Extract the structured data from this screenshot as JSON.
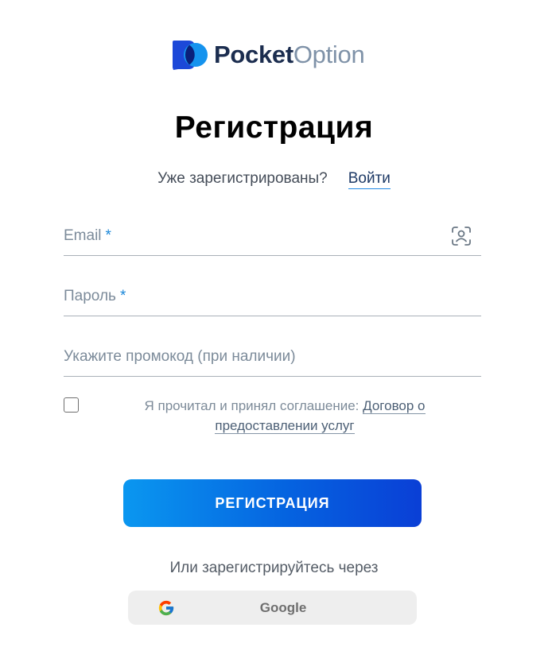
{
  "brand": {
    "name_part1": "Pocket",
    "name_part2": "Option",
    "colors": {
      "dark": "#1b2d4f",
      "muted": "#7f92a8",
      "primary_blue": "#0563e0",
      "accent_blue": "#1a87d9"
    },
    "icon": "pocket-option-logo-icon"
  },
  "page": {
    "title": "Регистрация"
  },
  "login": {
    "question": "Уже зарегистрированы?",
    "link_label": "Войти"
  },
  "form": {
    "email": {
      "label": "Email",
      "required_mark": "*",
      "value": "",
      "icon": "face-id-icon"
    },
    "password": {
      "label": "Пароль",
      "required_mark": "*",
      "value": ""
    },
    "promo": {
      "label": "Укажите промокод (при наличии)",
      "value": ""
    },
    "agreement": {
      "checked": false,
      "text": "Я прочитал и принял соглашение:",
      "link_label": "Договор о предоставлении услуг"
    },
    "submit_label": "РЕГИСТРАЦИЯ"
  },
  "social": {
    "prompt": "Или зарегистрируйтесь через",
    "google_label": "Google",
    "google_icon": "google-g-icon"
  }
}
